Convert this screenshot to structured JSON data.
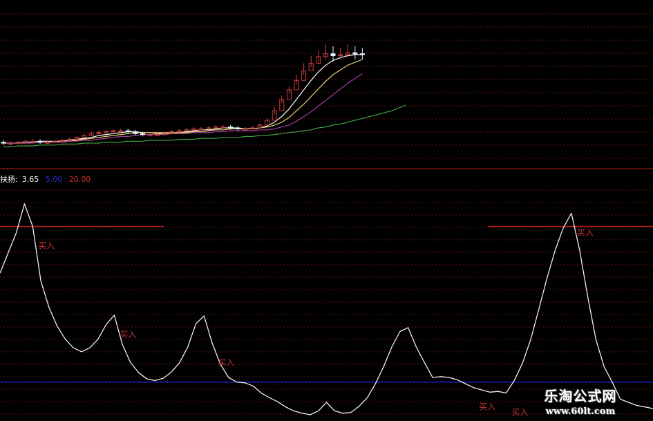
{
  "indicator": {
    "name_label": "扶扬:",
    "value": "3.65",
    "level_low": "5.00",
    "level_high": "20.00"
  },
  "colors": {
    "background": "#000000",
    "gridline": "#6b1010",
    "level_line": "#b02020",
    "blue_line": "#2020c0",
    "signal_text": "#c03030",
    "value_text": "#ffffff",
    "low_text": "#3030d0",
    "high_text": "#d03030",
    "oscillator": "#f0f0f0",
    "candle_up": "#d04040",
    "candle_down": "#e0f0ff",
    "ma_white": "#ffffff",
    "ma_yellow": "#e8d070",
    "ma_magenta": "#a040a0",
    "ma_green": "#40a040"
  },
  "chart_data": [
    {
      "type": "candlestick",
      "title": "",
      "series": [
        {
          "kind": "ohlc",
          "open": [
            25,
            24,
            24,
            25,
            26,
            26,
            25,
            25,
            26,
            27,
            28,
            30,
            32,
            34,
            35,
            36,
            37,
            37,
            36,
            34,
            33,
            33,
            33,
            34,
            36,
            37,
            38,
            39,
            39,
            40,
            41,
            41,
            40,
            39,
            39,
            40,
            43,
            48,
            58,
            70,
            80,
            90,
            100,
            108,
            115,
            118,
            116,
            117,
            119,
            118
          ],
          "close": [
            24,
            24,
            25,
            26,
            26,
            25,
            25,
            26,
            27,
            28,
            30,
            32,
            34,
            35,
            36,
            37,
            37,
            36,
            34,
            33,
            33,
            33,
            34,
            36,
            37,
            38,
            39,
            39,
            40,
            41,
            41,
            40,
            39,
            39,
            40,
            43,
            48,
            58,
            70,
            80,
            90,
            100,
            108,
            115,
            118,
            116,
            117,
            119,
            118,
            117
          ],
          "high": [
            27,
            26,
            26,
            27,
            28,
            28,
            27,
            27,
            28,
            30,
            32,
            34,
            36,
            37,
            38,
            39,
            39,
            39,
            38,
            36,
            35,
            35,
            36,
            38,
            39,
            40,
            41,
            41,
            42,
            43,
            43,
            43,
            42,
            41,
            42,
            45,
            50,
            62,
            74,
            84,
            96,
            108,
            116,
            122,
            128,
            126,
            124,
            128,
            126,
            124
          ],
          "low": [
            22,
            22,
            23,
            24,
            24,
            23,
            23,
            24,
            25,
            26,
            28,
            30,
            32,
            33,
            34,
            35,
            35,
            34,
            32,
            31,
            31,
            31,
            32,
            34,
            35,
            36,
            37,
            37,
            38,
            39,
            39,
            38,
            37,
            37,
            38,
            41,
            46,
            54,
            66,
            76,
            86,
            96,
            104,
            108,
            112,
            110,
            112,
            114,
            112,
            112
          ]
        },
        {
          "name": "",
          "kind": "ma",
          "color_key": "ma_white",
          "values": [
            24,
            24,
            24,
            25,
            25,
            26,
            26,
            26,
            26,
            27,
            28,
            29,
            30,
            32,
            33,
            34,
            35,
            36,
            36,
            35,
            35,
            34,
            34,
            34,
            35,
            36,
            37,
            38,
            38,
            39,
            40,
            40,
            40,
            39,
            39,
            40,
            42,
            46,
            52,
            60,
            70,
            80,
            90,
            99,
            106,
            111,
            114,
            116,
            117,
            117
          ]
        },
        {
          "name": "",
          "kind": "ma",
          "color_key": "ma_yellow",
          "values": [
            24,
            24,
            24,
            24,
            25,
            25,
            25,
            25,
            26,
            26,
            27,
            28,
            29,
            30,
            31,
            32,
            33,
            34,
            35,
            35,
            35,
            35,
            35,
            35,
            35,
            35,
            36,
            36,
            37,
            38,
            38,
            39,
            39,
            39,
            39,
            40,
            41,
            43,
            46,
            51,
            58,
            65,
            73,
            81,
            89,
            96,
            101,
            106,
            109,
            112
          ]
        },
        {
          "name": "",
          "kind": "ma",
          "color_key": "ma_magenta",
          "values": [
            24,
            24,
            24,
            24,
            24,
            25,
            25,
            25,
            25,
            26,
            26,
            27,
            27,
            28,
            29,
            30,
            31,
            31,
            32,
            33,
            33,
            33,
            33,
            34,
            34,
            34,
            35,
            35,
            35,
            36,
            36,
            37,
            37,
            37,
            37,
            38,
            38,
            39,
            41,
            43,
            47,
            52,
            57,
            63,
            69,
            75,
            81,
            87,
            92,
            97
          ]
        },
        {
          "name": "",
          "kind": "ma",
          "color_key": "ma_green",
          "values": [
            20,
            20,
            21,
            21,
            21,
            22,
            22,
            22,
            23,
            23,
            23,
            24,
            24,
            24,
            25,
            25,
            25,
            26,
            26,
            26,
            27,
            27,
            27,
            27,
            28,
            28,
            28,
            29,
            29,
            29,
            30,
            30,
            30,
            31,
            31,
            32,
            32,
            33,
            34,
            35,
            36,
            37,
            38,
            40,
            41,
            43,
            44,
            46,
            48,
            50,
            52,
            54,
            56,
            58,
            61,
            64
          ]
        }
      ],
      "ylim": [
        0,
        160
      ]
    },
    {
      "type": "line",
      "title": "",
      "series": [
        {
          "name": "",
          "kind": "oscillator",
          "x": [
            0,
            1,
            2,
            3,
            4,
            5,
            6,
            7,
            8,
            9,
            10,
            11,
            12,
            13,
            14,
            15,
            16,
            17,
            18,
            19,
            20,
            21,
            22,
            23,
            24,
            25,
            26,
            27,
            28,
            29,
            30,
            31,
            32,
            33,
            34,
            35,
            36,
            37,
            38,
            39,
            40,
            41,
            42,
            43,
            44,
            45,
            46,
            47,
            48,
            49,
            50,
            51,
            52,
            53,
            54,
            55,
            56,
            57,
            58,
            59,
            60,
            61,
            62,
            63,
            64,
            65,
            66,
            67,
            68,
            69,
            70,
            71,
            72,
            73,
            74,
            75,
            76,
            77,
            78,
            79,
            80
          ],
          "values": [
            19.0,
            21.6,
            24.2,
            27.9,
            25.0,
            18.0,
            14.6,
            12.2,
            10.5,
            9.4,
            8.9,
            9.4,
            10.5,
            12.4,
            13.6,
            9.8,
            7.5,
            6.2,
            5.4,
            5.2,
            5.5,
            6.3,
            7.5,
            9.5,
            12.5,
            13.5,
            10.0,
            7.3,
            5.6,
            5.0,
            4.9,
            4.5,
            3.6,
            3.0,
            2.5,
            1.8,
            1.3,
            1.0,
            0.8,
            1.3,
            2.4,
            1.3,
            1.0,
            1.1,
            1.9,
            3.0,
            4.8,
            7.0,
            9.5,
            11.5,
            12.0,
            9.5,
            7.5,
            5.6,
            5.7,
            5.6,
            5.3,
            4.8,
            4.3,
            4.0,
            3.7,
            3.8,
            3.6,
            5.2,
            7.4,
            10.4,
            14.3,
            18.3,
            21.9,
            24.8,
            26.7,
            22.0,
            16.0,
            10.5,
            7.0,
            5.0,
            2.8,
            2.4,
            2.0,
            1.8,
            1.6
          ]
        }
      ],
      "annotations": [
        {
          "text": "买入",
          "x": 4
        },
        {
          "text": "买入",
          "x": 14
        },
        {
          "text": "买入",
          "x": 26
        },
        {
          "text": "买入",
          "x": 58
        },
        {
          "text": "买入",
          "x": 62
        },
        {
          "text": "买入",
          "x": 70
        }
      ],
      "reference_lines": [
        {
          "value": 5,
          "color_key": "blue_line"
        },
        {
          "value": 25,
          "color_key": "level_line"
        }
      ],
      "ylim": [
        0,
        31
      ]
    }
  ],
  "watermark": {
    "line1": "乐淘公式网",
    "line2": "www.60lt.com"
  }
}
